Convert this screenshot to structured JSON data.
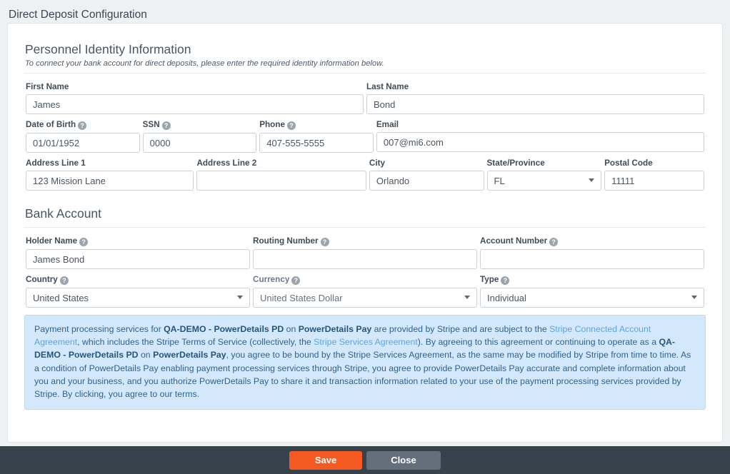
{
  "page": {
    "title": "Direct Deposit Configuration"
  },
  "identity": {
    "heading": "Personnel Identity Information",
    "subheading": "To connect your bank account for direct deposits, please enter the required identity information below.",
    "first_name": {
      "label": "First Name",
      "value": "James"
    },
    "last_name": {
      "label": "Last Name",
      "value": "Bond"
    },
    "dob": {
      "label": "Date of Birth",
      "value": "01/01/1952",
      "help": "help-icon"
    },
    "ssn": {
      "label": "SSN",
      "value": "0000",
      "help": "help-icon"
    },
    "phone": {
      "label": "Phone",
      "value": "407-555-5555",
      "help": "help-icon"
    },
    "email": {
      "label": "Email",
      "value": "007@mi6.com"
    },
    "address1": {
      "label": "Address Line 1",
      "value": "123 Mission Lane"
    },
    "address2": {
      "label": "Address Line 2",
      "value": ""
    },
    "city": {
      "label": "City",
      "value": "Orlando"
    },
    "state": {
      "label": "State/Province",
      "value": "FL"
    },
    "postal": {
      "label": "Postal Code",
      "value": "11111"
    }
  },
  "bank": {
    "heading": "Bank Account",
    "holder_name": {
      "label": "Holder Name",
      "value": "James Bond",
      "help": "help-icon"
    },
    "routing_number": {
      "label": "Routing Number",
      "value": "",
      "help": "help-icon"
    },
    "account_number": {
      "label": "Account Number",
      "value": "",
      "help": "help-icon"
    },
    "country": {
      "label": "Country",
      "value": "United States",
      "help": "help-icon"
    },
    "currency": {
      "label": "Currency",
      "value": "United States Dollar",
      "help": "help-icon"
    },
    "type": {
      "label": "Type",
      "value": "Individual",
      "help": "help-icon"
    }
  },
  "disclaimer": {
    "p1": "Payment processing services for ",
    "b1": "QA-DEMO - PowerDetails PD",
    "p2": " on ",
    "b2": "PowerDetails Pay",
    "p3": " are provided by Stripe and are subject to the ",
    "link1": "Stripe Connected Account Agreement",
    "p4": ", which includes the Stripe Terms of Service (collectively, the ",
    "link2": "Stripe Services Agreement",
    "p5": "). By agreeing to this agreement or continuing to operate as a ",
    "b3": "QA-DEMO - PowerDetails PD",
    "p6": " on ",
    "b4": "PowerDetails Pay",
    "p7": ", you agree to be bound by the Stripe Services Agreement, as the same may be modified by Stripe from time to time. As a condition of PowerDetails Pay enabling payment processing services through Stripe, you agree to provide PowerDetails Pay accurate and complete information about you and your business, and you authorize PowerDetails Pay to share it and transaction information related to your use of the payment processing services provided by Stripe. By clicking, you agree to our terms."
  },
  "footer": {
    "save_label": "Save",
    "close_label": "Close",
    "save_color": "#f55a22",
    "close_color": "#63707c"
  }
}
